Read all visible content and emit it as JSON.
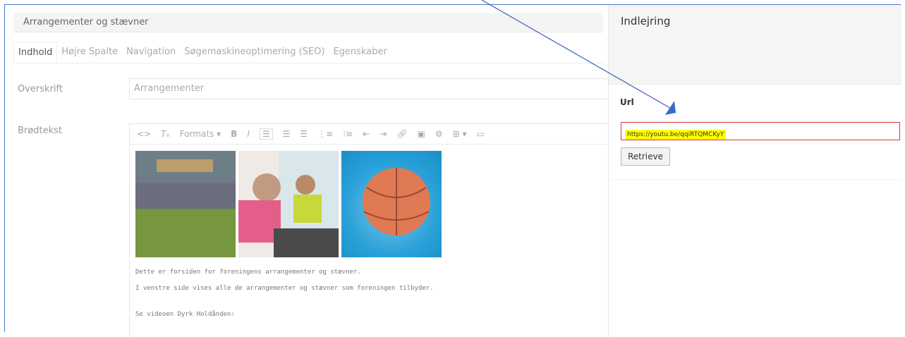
{
  "editor": {
    "page_title": "Arrangementer og stævner",
    "tabs": [
      "Indhold",
      "Højre Spalte",
      "Navigation",
      "Søgemaskineoptimering (SEO)",
      "Egenskaber"
    ],
    "heading_label": "Overskrift",
    "heading_value": "Arrangementer",
    "body_label": "Brødtekst",
    "toolbar": {
      "formats": "Formats ▾",
      "bold": "B",
      "italic": "I"
    },
    "paragraphs": [
      "Dette er forsiden for foreningens arrangementer og stævner.",
      "I venstre side vises alle de arrangementer og stævner som foreningen tilbyder.",
      "Se videoen Dyrk Holdånden:"
    ]
  },
  "panel": {
    "title": "Indlejring",
    "url_label": "Url",
    "url_value": "https://youtu.be/qqiRTQMCKyY",
    "retrieve_label": "Retrieve"
  },
  "colors": {
    "frame_border": "#4a7bd1",
    "arrow": "#3a5fb8",
    "url_border": "#dd3333",
    "highlight": "#ffff00"
  }
}
